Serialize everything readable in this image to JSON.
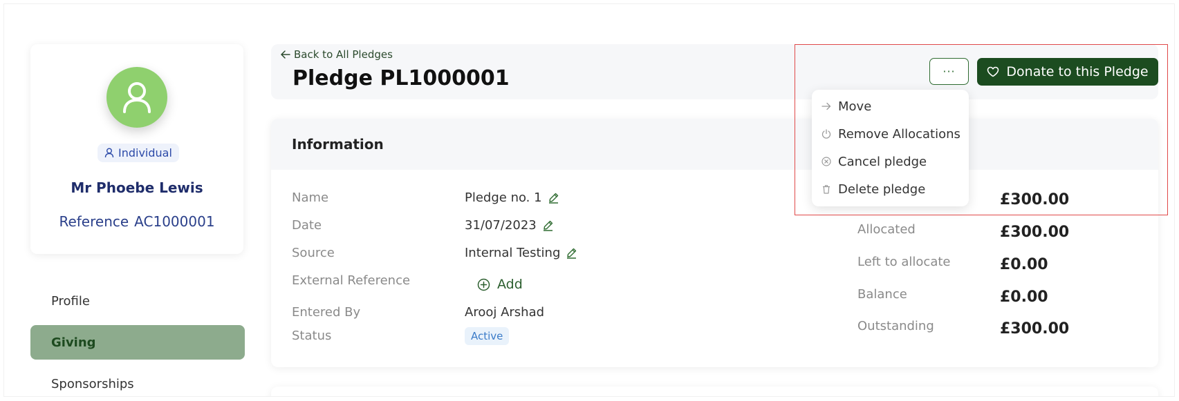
{
  "profile": {
    "type_badge": "Individual",
    "name": "Mr Phoebe Lewis",
    "reference_label": "Reference",
    "reference_value": "AC1000001"
  },
  "sidebar": {
    "items": [
      {
        "label": "Profile",
        "active": false
      },
      {
        "label": "Giving",
        "active": true
      },
      {
        "label": "Sponsorships",
        "active": false
      }
    ]
  },
  "header": {
    "back_link": "Back to All Pledges",
    "title": "Pledge PL1000001",
    "more_label": "···",
    "donate_label": "Donate to this Pledge"
  },
  "menu": {
    "items": [
      {
        "label": "Move",
        "icon": "arrow-right-icon"
      },
      {
        "label": "Remove Allocations",
        "icon": "power-icon"
      },
      {
        "label": "Cancel pledge",
        "icon": "x-circle-icon"
      },
      {
        "label": "Delete pledge",
        "icon": "trash-icon"
      }
    ]
  },
  "information": {
    "title": "Information",
    "fields": [
      {
        "label": "Name",
        "value": "Pledge no. 1",
        "editable": true
      },
      {
        "label": "Date",
        "value": "31/07/2023",
        "editable": true
      },
      {
        "label": "Source",
        "value": "Internal Testing",
        "editable": true
      },
      {
        "label": "External Reference",
        "value": "",
        "editable": false
      },
      {
        "label": "Entered By",
        "value": "Arooj Arshad",
        "editable": false
      },
      {
        "label": "Status",
        "value": "Active",
        "editable": false
      }
    ],
    "add_label": "Add",
    "summary": [
      {
        "label": "",
        "value": "£300.00"
      },
      {
        "label": "Allocated",
        "value": "£300.00"
      },
      {
        "label": "Left to allocate",
        "value": "£0.00"
      },
      {
        "label": "Balance",
        "value": "£0.00"
      },
      {
        "label": "Outstanding",
        "value": "£300.00"
      }
    ]
  },
  "colors": {
    "brand_green": "#1c4c20",
    "active_nav": "#8dab8d",
    "avatar": "#8fd06e",
    "highlight": "#e04848"
  }
}
